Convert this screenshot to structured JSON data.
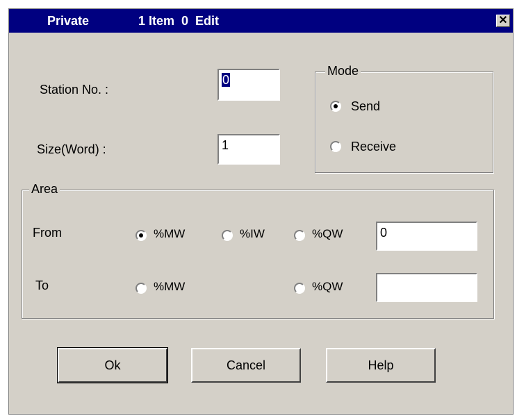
{
  "window": {
    "title_left": "Private",
    "title_right": "1 Item  0  Edit",
    "close_glyph": "✕"
  },
  "fields": {
    "station_label": "Station No. :",
    "station_value": "0",
    "size_label": "Size(Word) :",
    "size_value": "1"
  },
  "mode": {
    "label": "Mode",
    "options": [
      {
        "label": "Send",
        "selected": true
      },
      {
        "label": "Receive",
        "selected": false
      }
    ]
  },
  "area": {
    "label": "Area",
    "from": {
      "label": "From",
      "options": [
        {
          "label": "%MW",
          "selected": true
        },
        {
          "label": "%IW",
          "selected": false
        },
        {
          "label": "%QW",
          "selected": false
        }
      ],
      "value": "0"
    },
    "to": {
      "label": "To",
      "options": [
        {
          "label": "%MW",
          "selected": false
        },
        {
          "label": "%QW",
          "selected": false
        }
      ],
      "value": ""
    }
  },
  "buttons": {
    "ok": "Ok",
    "cancel": "Cancel",
    "help": "Help"
  },
  "colors": {
    "titlebar": "#000080",
    "face": "#d4d0c8"
  }
}
